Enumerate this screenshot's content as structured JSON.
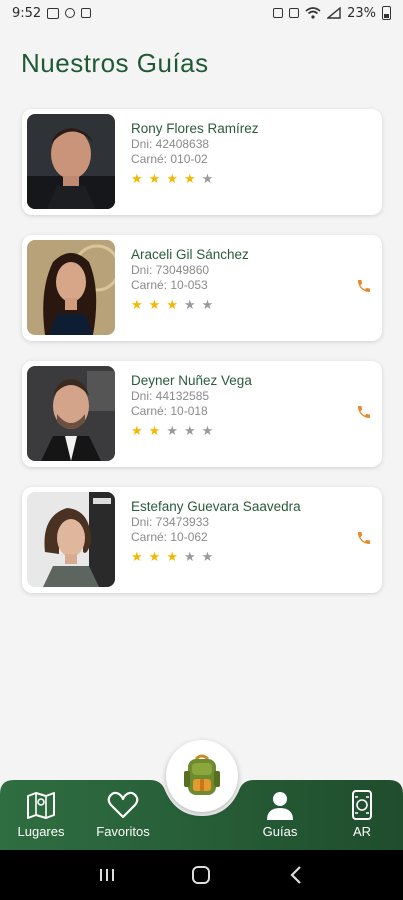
{
  "status_bar": {
    "time": "9:52",
    "battery": "23%"
  },
  "title": "Nuestros Guías",
  "guides": [
    {
      "name": "Rony Flores Ramírez",
      "dni": "Dni: 42408638",
      "carne": "Carné: 010-02",
      "rating": 4,
      "has_call": false
    },
    {
      "name": "Araceli Gil Sánchez",
      "dni": "Dni: 73049860",
      "carne": "Carné: 10-053",
      "rating": 3,
      "has_call": true
    },
    {
      "name": "Deyner Nuñez Vega",
      "dni": "Dni: 44132585",
      "carne": "Carné: 10-018",
      "rating": 2,
      "has_call": true
    },
    {
      "name": "Estefany Guevara Saavedra",
      "dni": "Dni: 73473933",
      "carne": "Carné: 10-062",
      "rating": 3,
      "has_call": true
    }
  ],
  "nav": {
    "lugares": "Lugares",
    "favoritos": "Favoritos",
    "guias": "Guías",
    "ar": "AR"
  },
  "colors": {
    "brand_green": "#1f5a33",
    "nav_green": "#2c6a3f",
    "star": "#f5b800",
    "call": "#e8892b"
  },
  "icons": [
    "map-icon",
    "heart-icon",
    "person-icon",
    "ar-phone-icon",
    "backpack-icon",
    "phone-icon"
  ]
}
